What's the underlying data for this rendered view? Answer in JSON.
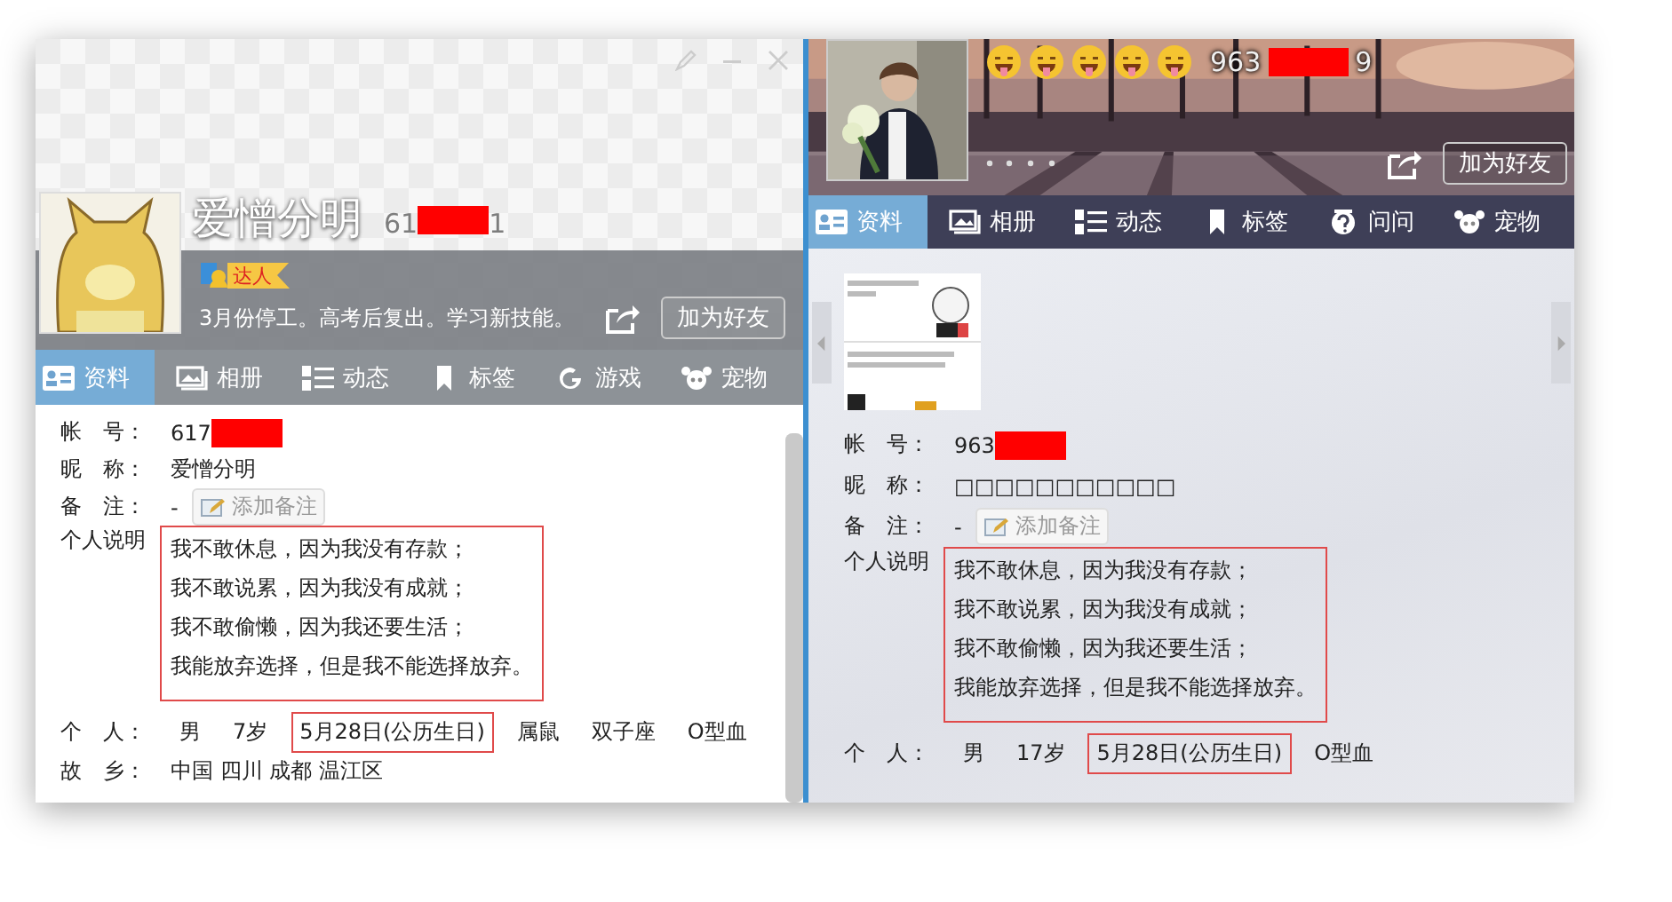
{
  "panels": [
    {
      "header": {
        "name": "爱憎分明",
        "id_start": "61",
        "id_end": "1",
        "badge": "达人",
        "signature": "3月份停工。高考后复出。学习新技能。",
        "add_friend": "加为好友"
      },
      "tabs": [
        {
          "label": "资料",
          "selected": true
        },
        {
          "label": "相册",
          "selected": false
        },
        {
          "label": "动态",
          "selected": false
        },
        {
          "label": "标签",
          "selected": false
        },
        {
          "label": "游戏",
          "selected": false
        },
        {
          "label": "宠物",
          "selected": false
        }
      ],
      "fields": [
        {
          "kind": "redacted",
          "label": "帐　号：",
          "value": "617"
        },
        {
          "kind": "text",
          "label": "昵　称：",
          "value": "爱憎分明"
        },
        {
          "kind": "note",
          "label": "备　注：",
          "value": "-",
          "button": "添加备注"
        },
        {
          "kind": "bio",
          "label": "个人说明",
          "lines": [
            "我不敢休息，因为我没有存款；",
            "我不敢说累，因为我没有成就；",
            "我不敢偷懒，因为我还要生活；",
            "我能放弃选择，但是我不能选择放弃。"
          ]
        },
        {
          "kind": "traits",
          "label": "个　人：",
          "items": [
            {
              "text": "男",
              "boxed": false
            },
            {
              "text": "7岁",
              "boxed": false
            },
            {
              "text": "5月28日(公历生日)",
              "boxed": true
            },
            {
              "text": "属鼠",
              "boxed": false
            },
            {
              "text": "双子座",
              "boxed": false
            },
            {
              "text": "O型血",
              "boxed": false
            }
          ]
        },
        {
          "kind": "text",
          "label": "故　乡：",
          "value": "中国 四川 成都 温江区"
        }
      ]
    },
    {
      "header": {
        "id_start": "963",
        "id_end": "9",
        "add_friend": "加为好友"
      },
      "tabs": [
        {
          "label": "资料",
          "selected": true
        },
        {
          "label": "相册",
          "selected": false
        },
        {
          "label": "动态",
          "selected": false
        },
        {
          "label": "标签",
          "selected": false
        },
        {
          "label": "问问",
          "selected": false
        },
        {
          "label": "宠物",
          "selected": false
        }
      ],
      "fields": [
        {
          "kind": "redacted",
          "label": "帐　号：",
          "value": "963"
        },
        {
          "kind": "text",
          "label": "昵　称：",
          "value": "□□□□□□□□□□□"
        },
        {
          "kind": "note",
          "label": "备　注：",
          "value": "-",
          "button": "添加备注"
        },
        {
          "kind": "bio",
          "label": "个人说明",
          "lines": [
            "我不敢休息，因为我没有存款；",
            "我不敢说累，因为我没有成就；",
            "我不敢偷懒，因为我还要生活；",
            "我能放弃选择，但是我不能选择放弃。"
          ]
        },
        {
          "kind": "traits",
          "label": "个　人：",
          "items": [
            {
              "text": "男",
              "boxed": false
            },
            {
              "text": "17岁",
              "boxed": false
            },
            {
              "text": "5月28日(公历生日)",
              "boxed": true
            },
            {
              "text": "O型血",
              "boxed": false
            }
          ]
        }
      ]
    }
  ]
}
